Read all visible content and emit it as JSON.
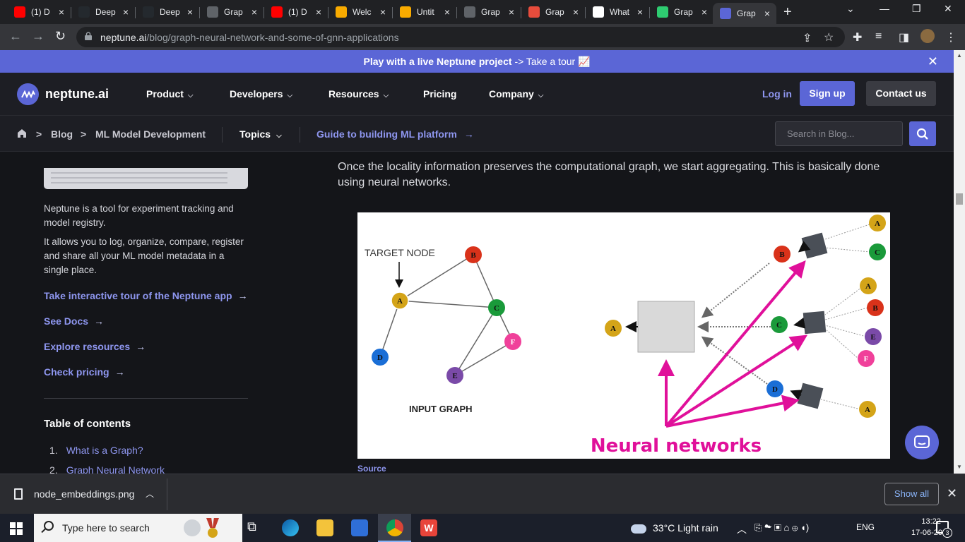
{
  "browser": {
    "tabs": [
      {
        "label": "(1) D",
        "icon": "youtube-icon",
        "color": "#ff0000"
      },
      {
        "label": "Deep",
        "icon": "github-icon",
        "color": "#24292e"
      },
      {
        "label": "Deep",
        "icon": "github-icon",
        "color": "#24292e"
      },
      {
        "label": "Grap",
        "icon": "chrome-icon",
        "color": "#5f6368"
      },
      {
        "label": "(1) D",
        "icon": "youtube-icon",
        "color": "#ff0000"
      },
      {
        "label": "Welc",
        "icon": "colab-icon",
        "color": "#f9ab00"
      },
      {
        "label": "Untit",
        "icon": "colab-icon",
        "color": "#f9ab00"
      },
      {
        "label": "Grap",
        "icon": "chrome-icon",
        "color": "#5f6368"
      },
      {
        "label": "Grap",
        "icon": "slides-icon",
        "color": "#e74c3c"
      },
      {
        "label": "What",
        "icon": "article-icon",
        "color": "#ffffff"
      },
      {
        "label": "Grap",
        "icon": "ai-icon",
        "color": "#2ecc71"
      },
      {
        "label": "Grap",
        "icon": "neptune-icon",
        "color": "#5b66d6"
      }
    ],
    "url_domain": "neptune.ai",
    "url_path": "/blog/graph-neural-network-and-some-of-gnn-applications"
  },
  "promo": {
    "bold": "Play with a live Neptune project",
    "link": "-> Take a tour 📈"
  },
  "nav": {
    "logo": "neptune.ai",
    "items": [
      "Product",
      "Developers",
      "Resources",
      "Pricing",
      "Company"
    ],
    "login": "Log in",
    "signup": "Sign up",
    "contact": "Contact us"
  },
  "subnav": {
    "crumbs": [
      "Blog",
      "ML Model Development"
    ],
    "topics": "Topics",
    "guide": "Guide to building ML platform",
    "search_placeholder": "Search in Blog..."
  },
  "sidebar": {
    "text1": "Neptune is a tool for experiment tracking and model registry.",
    "text2": "It allows you to log, organize, compare, register and share all your ML model metadata in a single place.",
    "links": [
      "Take interactive tour of the Neptune app",
      "See Docs",
      "Explore resources",
      "Check pricing"
    ],
    "toc_title": "Table of contents",
    "toc": [
      {
        "num": "1.",
        "label": "What is a Graph?"
      },
      {
        "num": "2.",
        "label": "Graph Neural Network"
      }
    ]
  },
  "article": {
    "paragraph": "Once the locality information preserves the computational graph, we start aggregating. This is basically done using neural networks.",
    "source": "Source"
  },
  "figure": {
    "target_label": "TARGET NODE",
    "input_label": "INPUT GRAPH",
    "nn_label": "Neural networks",
    "nodes": {
      "A": "A",
      "B": "B",
      "C": "C",
      "D": "D",
      "E": "E",
      "F": "F"
    }
  },
  "download": {
    "file": "node_embeddings.png",
    "show_all": "Show all"
  },
  "taskbar": {
    "search": "Type here to search",
    "weather": "33°C  Light rain",
    "lang": "ENG",
    "time": "13:22",
    "date": "17-06-2023",
    "notif": "3"
  }
}
